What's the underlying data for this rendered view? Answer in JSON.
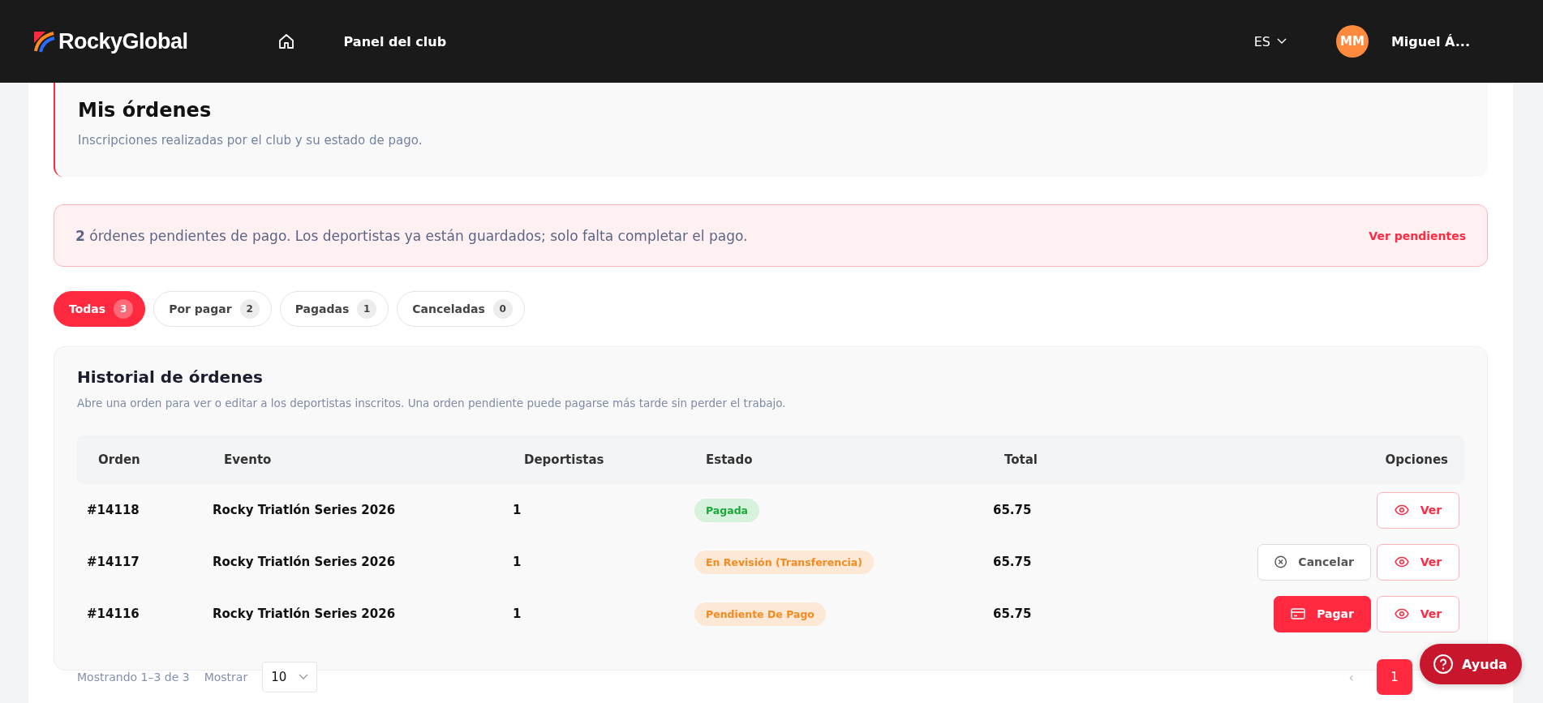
{
  "header": {
    "brand": "RockyGlobal",
    "nav": [
      {
        "label": "Panel del club"
      }
    ],
    "language": "ES",
    "avatar_initials": "MM",
    "user_name": "Miguel Á..."
  },
  "page": {
    "title": "Mis órdenes",
    "subtitle": "Inscripciones realizadas por el club y su estado de pago."
  },
  "alert": {
    "text": "**2** órdenes pendientes de pago. Los deportistas ya están guardados; solo falta completar el pago.",
    "link": "Ver pendientes"
  },
  "filters": [
    {
      "label": "Todas",
      "count": "3",
      "selected": true
    },
    {
      "label": "Por pagar",
      "count": "2",
      "selected": false
    },
    {
      "label": "Pagadas",
      "count": "1",
      "selected": false
    },
    {
      "label": "Canceladas",
      "count": "0",
      "selected": false
    }
  ],
  "history": {
    "title": "Historial de órdenes",
    "subtitle": "Abre una orden para ver o editar a los deportistas inscritos. Una orden pendiente puede pagarse más tarde sin perder el trabajo.",
    "columns": [
      "Orden",
      "Evento",
      "Deportistas",
      "Estado",
      "Total",
      "Opciones"
    ],
    "rows": [
      {
        "order": "#14118",
        "event": "Rocky Triatlón Series 2026",
        "athletes": "1",
        "status": "Pagada",
        "kind": "paid",
        "total": "65.75",
        "actions": [
          {
            "kind": "view",
            "label": "Ver"
          }
        ]
      },
      {
        "order": "#14117",
        "event": "Rocky Triatlón Series 2026",
        "athletes": "1",
        "status": "En Revisión (Transferencia)",
        "kind": "review",
        "total": "65.75",
        "actions": [
          {
            "kind": "cancel",
            "label": "Cancelar"
          },
          {
            "kind": "view",
            "label": "Ver"
          }
        ]
      },
      {
        "order": "#14116",
        "event": "Rocky Triatlón Series 2026",
        "athletes": "1",
        "status": "Pendiente De Pago",
        "kind": "pending",
        "total": "65.75",
        "actions": [
          {
            "kind": "pay",
            "label": "Pagar"
          },
          {
            "kind": "view",
            "label": "Ver"
          }
        ]
      }
    ],
    "footer": {
      "showing": "Mostrando 1–3 de 3",
      "show_label": "Mostrar",
      "page_size": "10",
      "prev": "‹",
      "pages": [
        {
          "label": "1",
          "selected": true
        }
      ]
    }
  },
  "help_button": "Ayuda"
}
